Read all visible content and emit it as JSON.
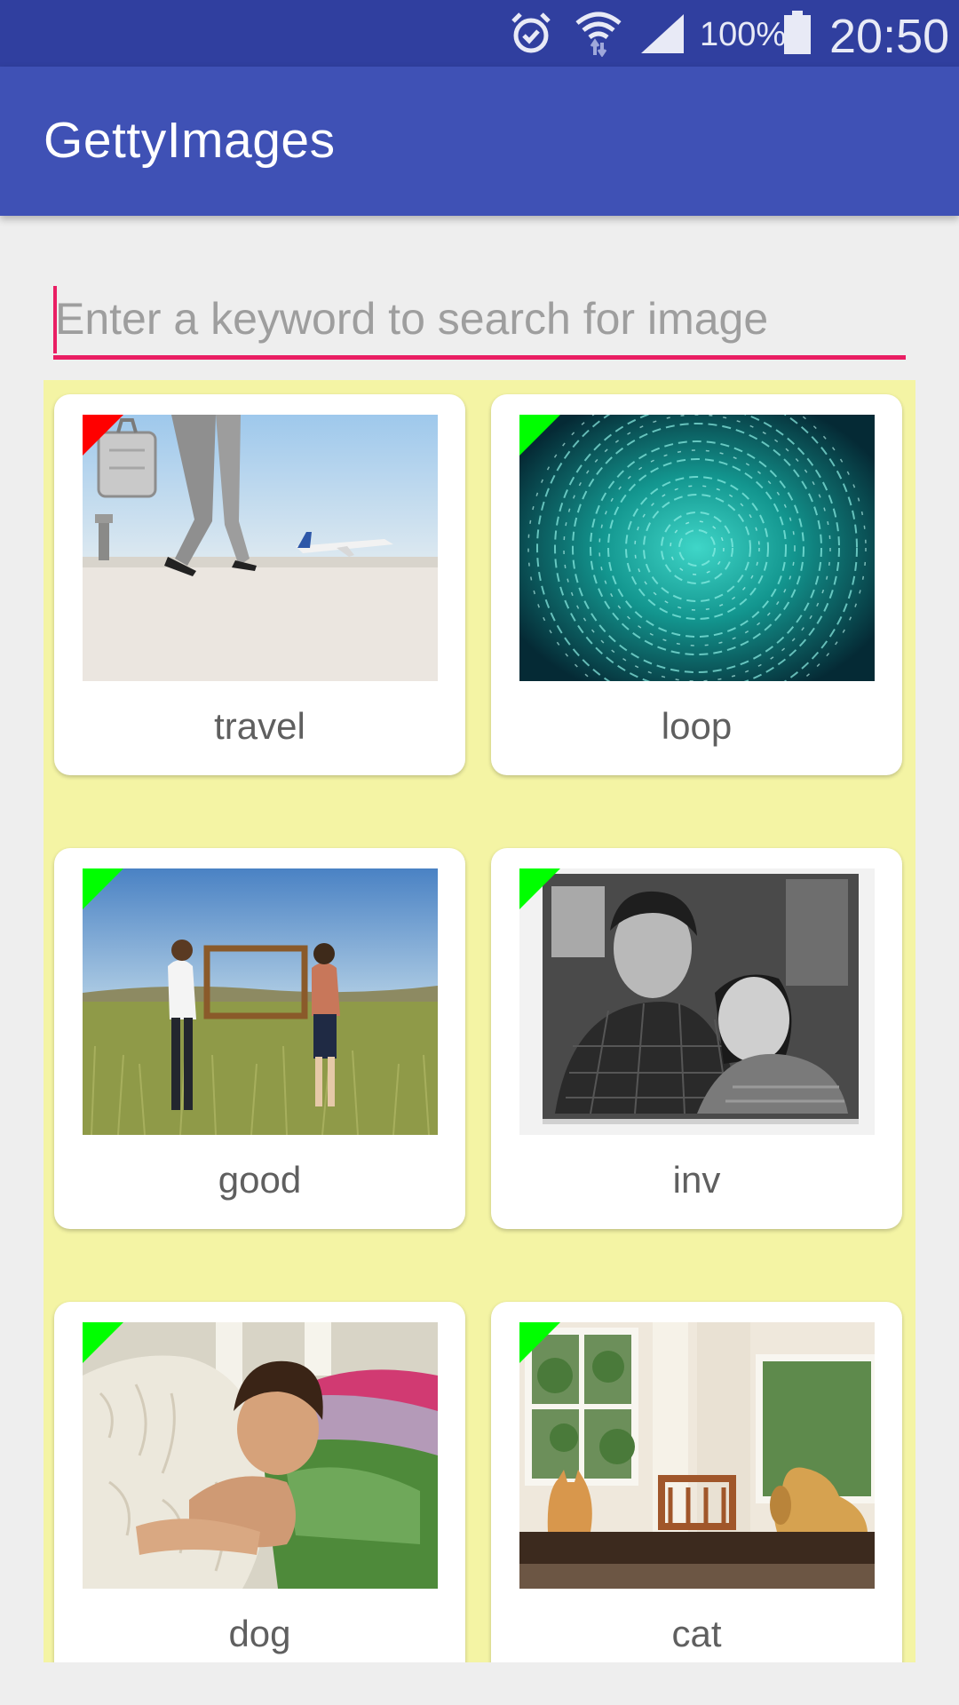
{
  "status_bar": {
    "icons": [
      "alarm-icon",
      "wifi-icon",
      "signal-icon",
      "battery-icon"
    ],
    "battery": "100%",
    "time": "20:50"
  },
  "app_bar": {
    "title": "GettyImages"
  },
  "search": {
    "placeholder": "Enter a keyword to search for image",
    "value": "",
    "accent": "#e91e63"
  },
  "colors": {
    "status_bar": "#303f9f",
    "app_bar": "#3f51b5",
    "grid_bg": "#f4f4a4",
    "flag_red": "#ff0000",
    "flag_green": "#00ff00"
  },
  "images": [
    {
      "label": "travel",
      "flag": "red"
    },
    {
      "label": "loop",
      "flag": "green"
    },
    {
      "label": "good",
      "flag": "green"
    },
    {
      "label": "inv",
      "flag": "green"
    },
    {
      "label": "dog",
      "flag": "green"
    },
    {
      "label": "cat",
      "flag": "green"
    }
  ]
}
